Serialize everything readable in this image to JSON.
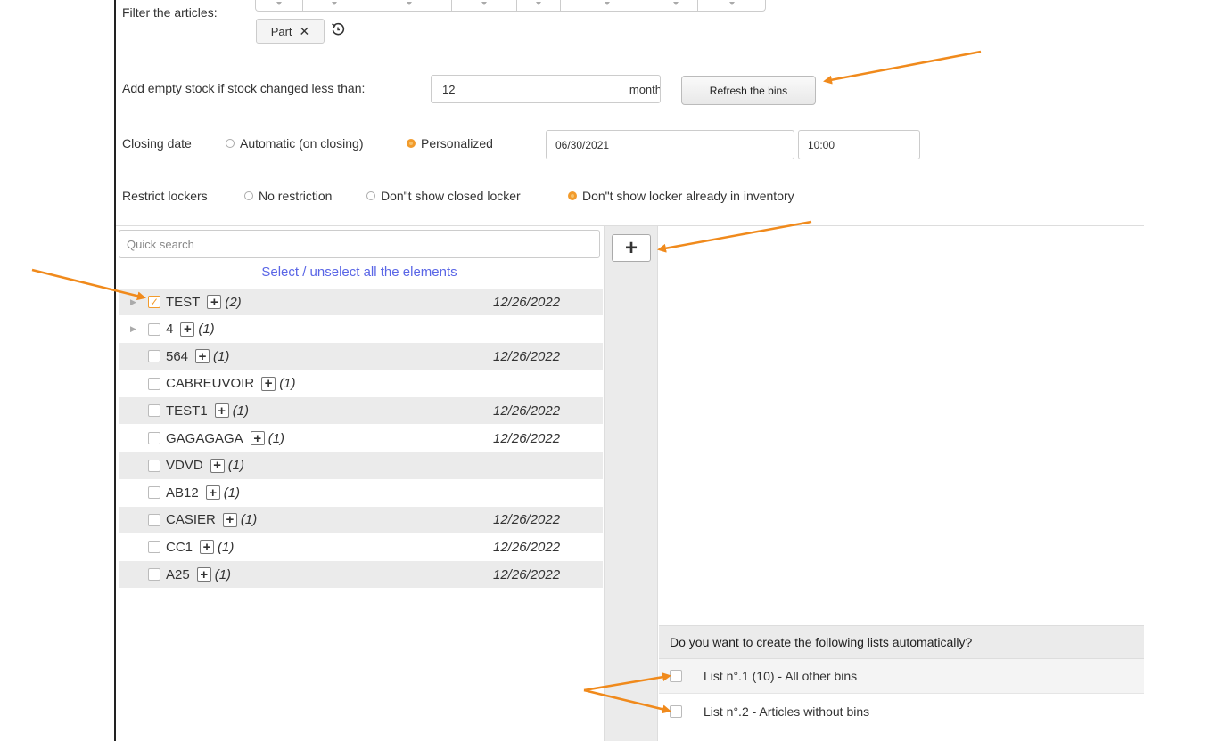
{
  "filter": {
    "label": "Filter the articles:",
    "chip_label": "Part",
    "chip_remove": "✕"
  },
  "stock": {
    "label": "Add empty stock if stock changed less than:",
    "value": "12",
    "unit": "month",
    "refresh_label": "Refresh the bins"
  },
  "closing": {
    "label": "Closing date",
    "options": [
      {
        "label": "Automatic (on closing)",
        "selected": false
      },
      {
        "label": "Personalized",
        "selected": true
      }
    ],
    "date": "06/30/2021",
    "time": "10:00"
  },
  "restrict": {
    "label": "Restrict lockers",
    "options": [
      {
        "label": "No restriction",
        "selected": false
      },
      {
        "label": "Don\"t show closed locker",
        "selected": false
      },
      {
        "label": "Don\"t show locker already in inventory",
        "selected": true
      }
    ]
  },
  "left_panel": {
    "search_placeholder": "Quick search",
    "select_all": "Select / unselect all the elements",
    "items": [
      {
        "name": "TEST",
        "count": "(2)",
        "date": "12/26/2022",
        "checked": true,
        "expandable": true
      },
      {
        "name": "4",
        "count": "(1)",
        "date": "",
        "checked": false,
        "expandable": true
      },
      {
        "name": "564",
        "count": "(1)",
        "date": "12/26/2022",
        "checked": false,
        "expandable": false
      },
      {
        "name": "CABREUVOIR",
        "count": "(1)",
        "date": "",
        "checked": false,
        "expandable": false
      },
      {
        "name": "TEST1",
        "count": "(1)",
        "date": "12/26/2022",
        "checked": false,
        "expandable": false
      },
      {
        "name": "GAGAGAGA",
        "count": "(1)",
        "date": "12/26/2022",
        "checked": false,
        "expandable": false
      },
      {
        "name": "VDVD",
        "count": "(1)",
        "date": "",
        "checked": false,
        "expandable": false
      },
      {
        "name": "AB12",
        "count": "(1)",
        "date": "",
        "checked": false,
        "expandable": false
      },
      {
        "name": "CASIER",
        "count": "(1)",
        "date": "12/26/2022",
        "checked": false,
        "expandable": false
      },
      {
        "name": "CC1",
        "count": "(1)",
        "date": "12/26/2022",
        "checked": false,
        "expandable": false
      },
      {
        "name": "A25",
        "count": "(1)",
        "date": "12/26/2022",
        "checked": false,
        "expandable": false
      }
    ]
  },
  "auto_lists": {
    "question": "Do you want to create the following lists automatically?",
    "lists": [
      {
        "label": "List n°.1 (10) - All other bins"
      },
      {
        "label": "List n°.2 - Articles without bins"
      }
    ]
  },
  "icons": {
    "add": "plus-icon",
    "reset": "reset-icon",
    "remove": "close-icon",
    "check": "checkmark-icon",
    "expand": "triangle-right-icon"
  },
  "colors": {
    "accent": "#f29b2c",
    "link": "#5a66e6",
    "annotation_arrow": "#f08a1c"
  }
}
